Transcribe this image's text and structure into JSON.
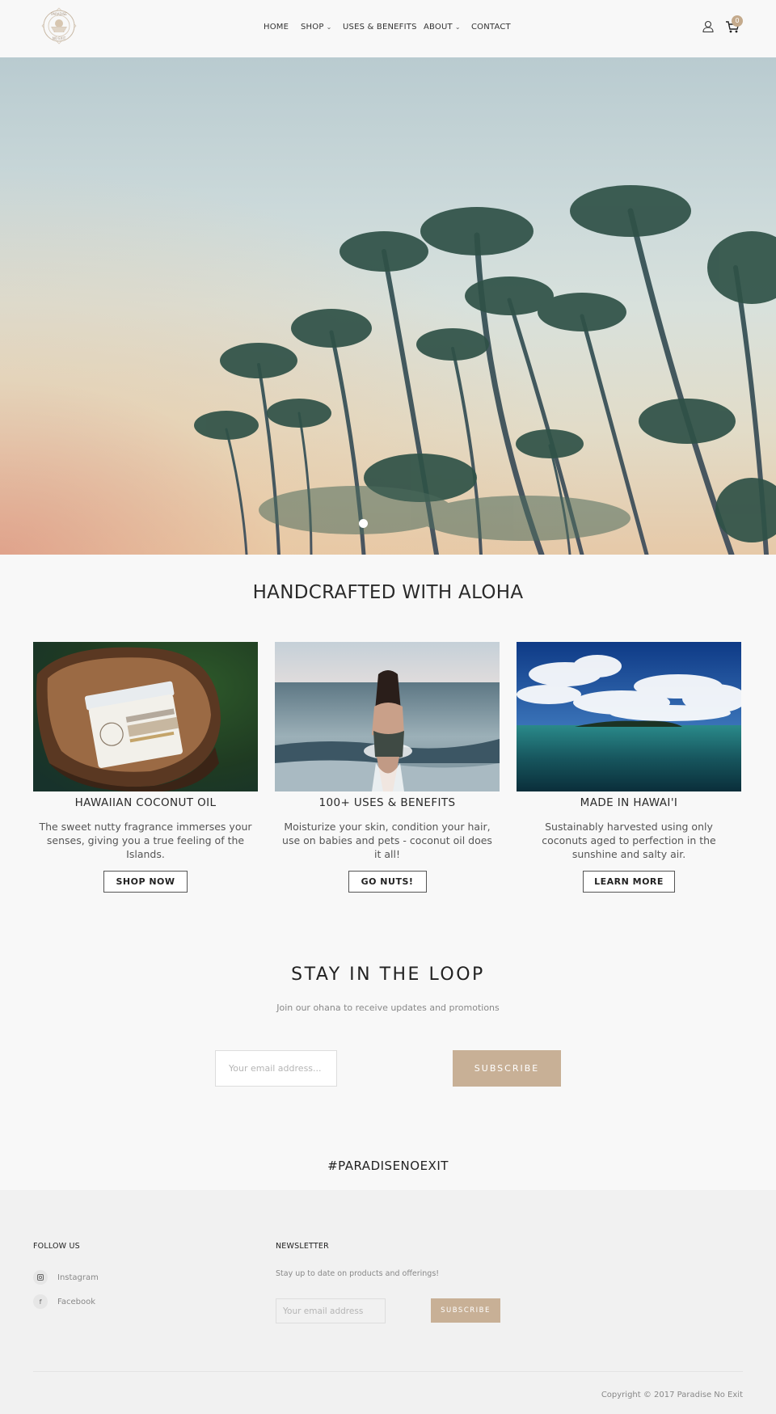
{
  "brand": {
    "name": "Paradise No Exit",
    "logo_text_top": "PARADISE",
    "logo_text_bottom": "NO EXIT",
    "accent_color": "#c8b096"
  },
  "nav": {
    "items": [
      {
        "label": "HOME",
        "has_dropdown": false
      },
      {
        "label": "SHOP",
        "has_dropdown": true
      },
      {
        "label": "USES & BENEFITS",
        "has_dropdown": false
      },
      {
        "label": "ABOUT",
        "has_dropdown": true
      },
      {
        "label": "CONTACT",
        "has_dropdown": false
      }
    ],
    "dropdown_glyph": "⌄",
    "account_icon": "user-icon",
    "cart_icon": "cart-icon",
    "cart_count": "0"
  },
  "hero": {
    "image": "palm-trees-sunset",
    "slides_count": 1,
    "active_slide": 1
  },
  "features": {
    "heading": "HANDCRAFTED WITH ALOHA",
    "cards": [
      {
        "image": "coconut-oil-jar-in-coconut-shell",
        "title": "HAWAIIAN COCONUT OIL",
        "text": "The sweet nutty fragrance immerses your senses, giving you a true feeling of the Islands.",
        "button": "SHOP NOW"
      },
      {
        "image": "woman-in-ocean-waves",
        "title": "100+ USES & BENEFITS",
        "text": "Moisturize your skin, condition your hair, use on babies and pets - coconut oil does it all!",
        "button": "GO NUTS!"
      },
      {
        "image": "island-ocean-blue-sky",
        "title": "MADE IN HAWAI'I",
        "text": "Sustainably harvested using only coconuts aged to perfection in the sunshine and salty air.",
        "button": "LEARN MORE"
      }
    ]
  },
  "newsletter": {
    "heading": "STAY IN THE LOOP",
    "subheading": "Join our ohana to receive updates and promotions",
    "email_placeholder": "Your email address...",
    "email_value": "",
    "button": "SUBSCRIBE"
  },
  "hashtag": "#PARADISENOEXIT",
  "footer": {
    "follow_heading": "FOLLOW US",
    "social": [
      {
        "icon": "instagram-icon",
        "glyph": "◙",
        "label": "Instagram"
      },
      {
        "icon": "facebook-icon",
        "glyph": "f",
        "label": "Facebook"
      }
    ],
    "newsletter_heading": "NEWSLETTER",
    "newsletter_text": "Stay up to date on products and offerings!",
    "email_placeholder": "Your email address",
    "email_value": "",
    "button": "SUBSCRIBE",
    "copyright": "Copyright © 2017 Paradise No Exit"
  }
}
